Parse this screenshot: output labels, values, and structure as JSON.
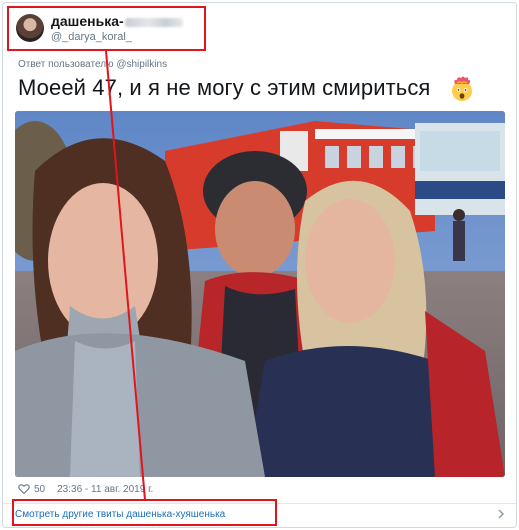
{
  "tweet": {
    "author_name": "дашенька-",
    "author_handle": "@_darya_koral_",
    "reply_prefix": "Ответ пользователю",
    "reply_mention": "@shipilkins",
    "text": "Моеей 47, и я не могу с этим смириться",
    "emoji": "exploding-head-emoji",
    "likes": "50",
    "timestamp": "23:36 - 11 авг. 2019 г."
  },
  "footer": {
    "more_link": "Смотреть другие твиты дашенька-хуяшенька"
  },
  "icons": {
    "like": "heart-icon",
    "more": "chevron-right-icon"
  },
  "colors": {
    "highlight": "#e3141c",
    "link": "#1b6fba",
    "muted": "#657786"
  }
}
